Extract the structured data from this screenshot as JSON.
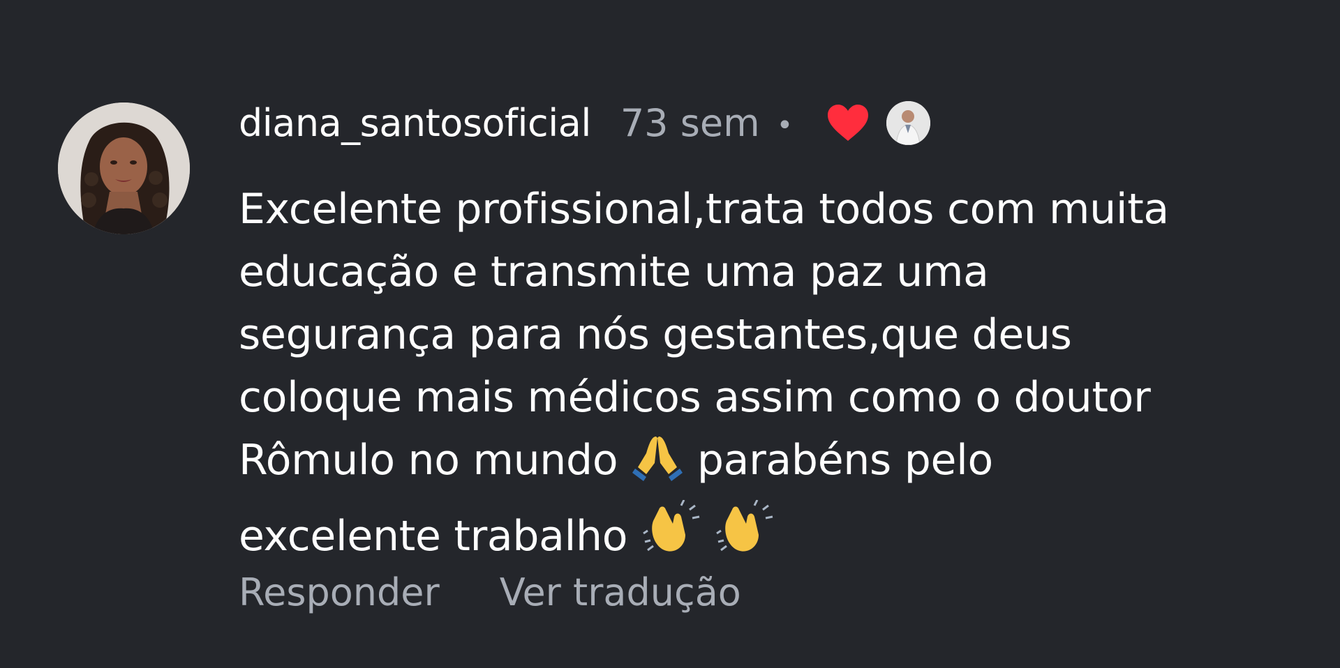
{
  "comment": {
    "username": "diana_santosoficial",
    "time_ago": "73 sem",
    "separator": "•",
    "body_lines": [
      "Excelente profissional,trata todos com muita",
      "educação e transmite uma paz uma",
      "segurança para nós gestantes,que deus",
      "coloque mais médicos assim como o doutor",
      "Rômulo no mundo",
      "parabéns pelo",
      "excelente trabalho"
    ],
    "emojis": {
      "pray": "folded-hands",
      "clap": "clapping-hands"
    },
    "liked_by_author": true,
    "heart_color": "#ff2d3d"
  },
  "actions": {
    "reply_label": "Responder",
    "translate_label": "Ver tradução"
  },
  "colors": {
    "background": "#24262b",
    "text": "#ffffff",
    "muted": "#a8adb6"
  }
}
